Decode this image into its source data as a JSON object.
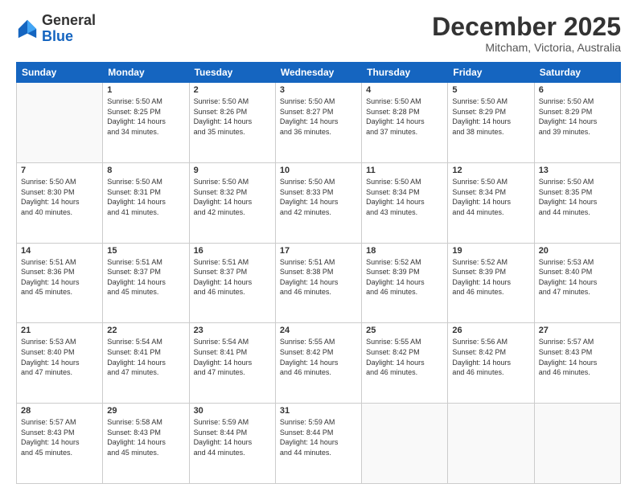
{
  "logo": {
    "general": "General",
    "blue": "Blue"
  },
  "header": {
    "month": "December 2025",
    "location": "Mitcham, Victoria, Australia"
  },
  "weekdays": [
    "Sunday",
    "Monday",
    "Tuesday",
    "Wednesday",
    "Thursday",
    "Friday",
    "Saturday"
  ],
  "weeks": [
    [
      {
        "day": "",
        "info": ""
      },
      {
        "day": "1",
        "info": "Sunrise: 5:50 AM\nSunset: 8:25 PM\nDaylight: 14 hours\nand 34 minutes."
      },
      {
        "day": "2",
        "info": "Sunrise: 5:50 AM\nSunset: 8:26 PM\nDaylight: 14 hours\nand 35 minutes."
      },
      {
        "day": "3",
        "info": "Sunrise: 5:50 AM\nSunset: 8:27 PM\nDaylight: 14 hours\nand 36 minutes."
      },
      {
        "day": "4",
        "info": "Sunrise: 5:50 AM\nSunset: 8:28 PM\nDaylight: 14 hours\nand 37 minutes."
      },
      {
        "day": "5",
        "info": "Sunrise: 5:50 AM\nSunset: 8:29 PM\nDaylight: 14 hours\nand 38 minutes."
      },
      {
        "day": "6",
        "info": "Sunrise: 5:50 AM\nSunset: 8:29 PM\nDaylight: 14 hours\nand 39 minutes."
      }
    ],
    [
      {
        "day": "7",
        "info": "Sunrise: 5:50 AM\nSunset: 8:30 PM\nDaylight: 14 hours\nand 40 minutes."
      },
      {
        "day": "8",
        "info": "Sunrise: 5:50 AM\nSunset: 8:31 PM\nDaylight: 14 hours\nand 41 minutes."
      },
      {
        "day": "9",
        "info": "Sunrise: 5:50 AM\nSunset: 8:32 PM\nDaylight: 14 hours\nand 42 minutes."
      },
      {
        "day": "10",
        "info": "Sunrise: 5:50 AM\nSunset: 8:33 PM\nDaylight: 14 hours\nand 42 minutes."
      },
      {
        "day": "11",
        "info": "Sunrise: 5:50 AM\nSunset: 8:34 PM\nDaylight: 14 hours\nand 43 minutes."
      },
      {
        "day": "12",
        "info": "Sunrise: 5:50 AM\nSunset: 8:34 PM\nDaylight: 14 hours\nand 44 minutes."
      },
      {
        "day": "13",
        "info": "Sunrise: 5:50 AM\nSunset: 8:35 PM\nDaylight: 14 hours\nand 44 minutes."
      }
    ],
    [
      {
        "day": "14",
        "info": "Sunrise: 5:51 AM\nSunset: 8:36 PM\nDaylight: 14 hours\nand 45 minutes."
      },
      {
        "day": "15",
        "info": "Sunrise: 5:51 AM\nSunset: 8:37 PM\nDaylight: 14 hours\nand 45 minutes."
      },
      {
        "day": "16",
        "info": "Sunrise: 5:51 AM\nSunset: 8:37 PM\nDaylight: 14 hours\nand 46 minutes."
      },
      {
        "day": "17",
        "info": "Sunrise: 5:51 AM\nSunset: 8:38 PM\nDaylight: 14 hours\nand 46 minutes."
      },
      {
        "day": "18",
        "info": "Sunrise: 5:52 AM\nSunset: 8:39 PM\nDaylight: 14 hours\nand 46 minutes."
      },
      {
        "day": "19",
        "info": "Sunrise: 5:52 AM\nSunset: 8:39 PM\nDaylight: 14 hours\nand 46 minutes."
      },
      {
        "day": "20",
        "info": "Sunrise: 5:53 AM\nSunset: 8:40 PM\nDaylight: 14 hours\nand 47 minutes."
      }
    ],
    [
      {
        "day": "21",
        "info": "Sunrise: 5:53 AM\nSunset: 8:40 PM\nDaylight: 14 hours\nand 47 minutes."
      },
      {
        "day": "22",
        "info": "Sunrise: 5:54 AM\nSunset: 8:41 PM\nDaylight: 14 hours\nand 47 minutes."
      },
      {
        "day": "23",
        "info": "Sunrise: 5:54 AM\nSunset: 8:41 PM\nDaylight: 14 hours\nand 47 minutes."
      },
      {
        "day": "24",
        "info": "Sunrise: 5:55 AM\nSunset: 8:42 PM\nDaylight: 14 hours\nand 46 minutes."
      },
      {
        "day": "25",
        "info": "Sunrise: 5:55 AM\nSunset: 8:42 PM\nDaylight: 14 hours\nand 46 minutes."
      },
      {
        "day": "26",
        "info": "Sunrise: 5:56 AM\nSunset: 8:42 PM\nDaylight: 14 hours\nand 46 minutes."
      },
      {
        "day": "27",
        "info": "Sunrise: 5:57 AM\nSunset: 8:43 PM\nDaylight: 14 hours\nand 46 minutes."
      }
    ],
    [
      {
        "day": "28",
        "info": "Sunrise: 5:57 AM\nSunset: 8:43 PM\nDaylight: 14 hours\nand 45 minutes."
      },
      {
        "day": "29",
        "info": "Sunrise: 5:58 AM\nSunset: 8:43 PM\nDaylight: 14 hours\nand 45 minutes."
      },
      {
        "day": "30",
        "info": "Sunrise: 5:59 AM\nSunset: 8:44 PM\nDaylight: 14 hours\nand 44 minutes."
      },
      {
        "day": "31",
        "info": "Sunrise: 5:59 AM\nSunset: 8:44 PM\nDaylight: 14 hours\nand 44 minutes."
      },
      {
        "day": "",
        "info": ""
      },
      {
        "day": "",
        "info": ""
      },
      {
        "day": "",
        "info": ""
      }
    ]
  ]
}
